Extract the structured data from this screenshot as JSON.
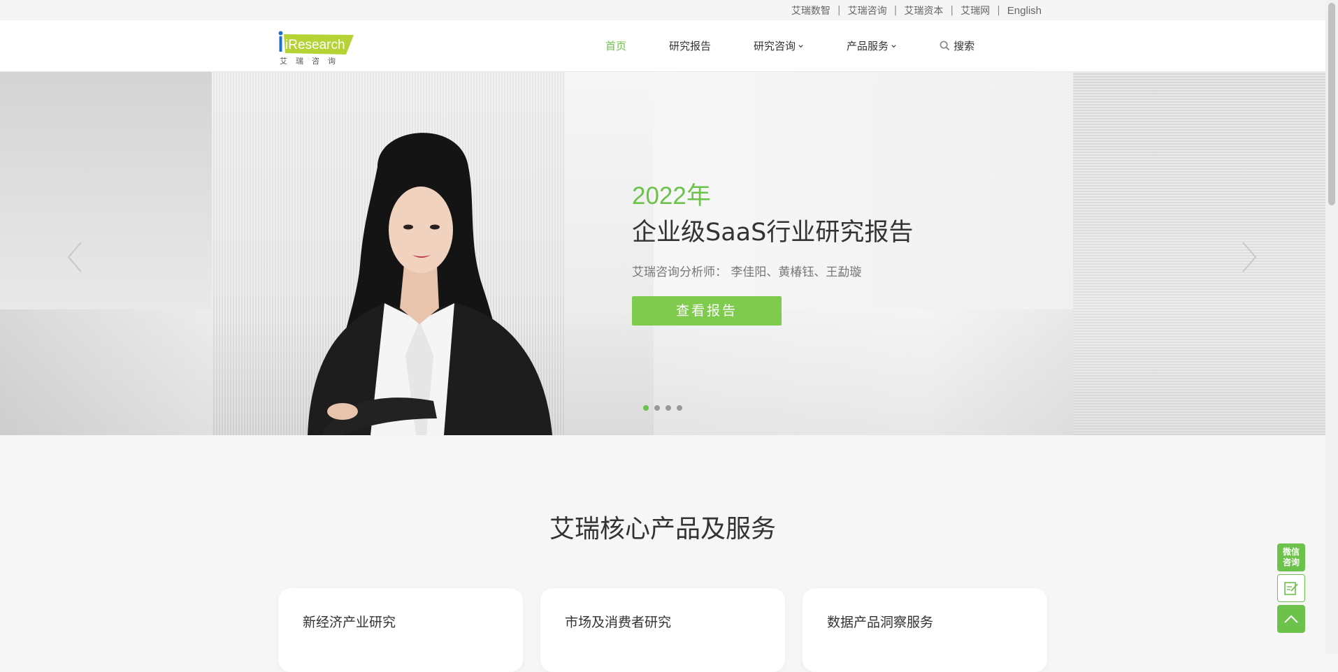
{
  "topbar": {
    "links": [
      "艾瑞数智",
      "艾瑞咨询",
      "艾瑞资本",
      "艾瑞网",
      "English"
    ],
    "separator": "|"
  },
  "header": {
    "logo_text": "iResearch",
    "logo_sub": "艾瑞咨询",
    "nav": [
      {
        "label": "首页",
        "active": true
      },
      {
        "label": "研究报告"
      },
      {
        "label": "研究咨询",
        "dropdown": true
      },
      {
        "label": "产品服务",
        "dropdown": true
      }
    ],
    "search_label": "搜索"
  },
  "banner": {
    "year": "2022年",
    "title": "企业级SaaS行业研究报告",
    "authors": "艾瑞咨询分析师：  李佳阳、黄椿钰、王勐璇",
    "button_label": "查看报告",
    "slide_count": 4,
    "active_slide": 1
  },
  "section": {
    "title": "艾瑞核心产品及服务",
    "cards": [
      "新经济产业研究",
      "市场及消费者研究",
      "数据产品洞察服务"
    ]
  },
  "float_tools": {
    "wechat_label": "微信咨询"
  },
  "colors": {
    "accent": "#6cc24a",
    "button": "#7ecb4e",
    "text": "#333333"
  }
}
